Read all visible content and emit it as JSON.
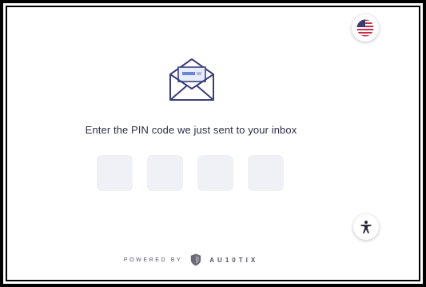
{
  "language": {
    "icon": "us-flag-icon"
  },
  "prompt": {
    "text": "Enter the PIN code we just sent to your inbox"
  },
  "pin_fields": [
    {
      "value": ""
    },
    {
      "value": ""
    },
    {
      "value": ""
    },
    {
      "value": ""
    }
  ],
  "accessibility": {
    "icon": "accessibility-person-icon"
  },
  "footer": {
    "powered_by": "POWERED BY",
    "brand": "AU10TIX",
    "brand_icon": "shield-logo-icon"
  },
  "colors": {
    "accent": "#3b3f7a",
    "pin_box_bg": "#f0f1f6",
    "text": "#2d2d44"
  }
}
